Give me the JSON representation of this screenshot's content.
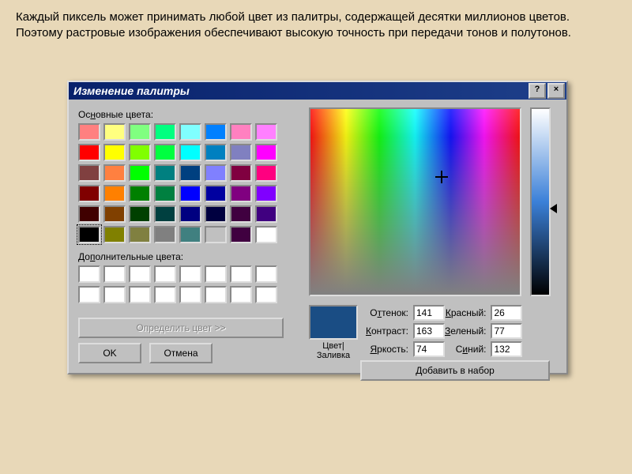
{
  "description": "Каждый пиксель может принимать любой цвет из палитры, содержащей десятки миллионов цветов. Поэтому растровые изображения обеспечивают высокую точность при передачи тонов и полутонов.",
  "dialog": {
    "title": "Изменение палитры",
    "help_symbol": "?",
    "close_symbol": "×",
    "basic_label": "Основные цвета:",
    "custom_label": "Дополнительные цвета:",
    "define_label": "Определить цвет >>",
    "ok_label": "OK",
    "cancel_label": "Отмена",
    "preview_label": "Цвет|Заливка",
    "add_label": "Добавить в набор",
    "fields": {
      "hue_label": "Оттенок:",
      "sat_label": "Контраст:",
      "lum_label": "Яркость:",
      "red_label": "Красный:",
      "green_label": "Зеленый:",
      "blue_label": "Синий:",
      "hue": "141",
      "sat": "163",
      "lum": "74",
      "red": "26",
      "green": "77",
      "blue": "132"
    },
    "basic_colors": [
      "#ff8080",
      "#ffff80",
      "#80ff80",
      "#00ff80",
      "#80ffff",
      "#0080ff",
      "#ff80c0",
      "#ff80ff",
      "#ff0000",
      "#ffff00",
      "#80ff00",
      "#00ff40",
      "#00ffff",
      "#0080c0",
      "#8080c0",
      "#ff00ff",
      "#804040",
      "#ff8040",
      "#00ff00",
      "#008080",
      "#004080",
      "#8080ff",
      "#800040",
      "#ff0080",
      "#800000",
      "#ff8000",
      "#008000",
      "#008040",
      "#0000ff",
      "#0000a0",
      "#800080",
      "#8000ff",
      "#400000",
      "#804000",
      "#004000",
      "#004040",
      "#000080",
      "#000040",
      "#400040",
      "#400080",
      "#000000",
      "#808000",
      "#808040",
      "#808080",
      "#408080",
      "#c0c0c0",
      "#400040",
      "#ffffff"
    ],
    "custom_colors": [
      "#ffffff",
      "#ffffff",
      "#ffffff",
      "#ffffff",
      "#ffffff",
      "#ffffff",
      "#ffffff",
      "#ffffff",
      "#ffffff",
      "#ffffff",
      "#ffffff",
      "#ffffff",
      "#ffffff",
      "#ffffff",
      "#ffffff",
      "#ffffff"
    ],
    "selected_basic_index": 40
  }
}
